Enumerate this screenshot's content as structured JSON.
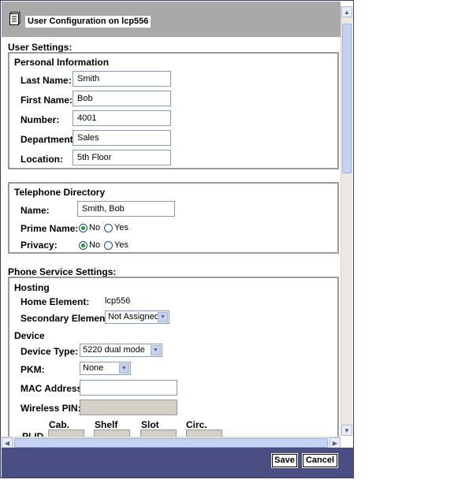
{
  "window": {
    "title": "User Configuration on lcp556",
    "icon": "document-icon"
  },
  "user_settings": {
    "heading": "User Settings:",
    "personal": {
      "heading": "Personal Information",
      "last_name": {
        "label": "Last Name:",
        "value": "Smith"
      },
      "first_name": {
        "label": "First Name:",
        "value": "Bob"
      },
      "number": {
        "label": "Number:",
        "value": "4001"
      },
      "department": {
        "label": "Department:",
        "value": "Sales"
      },
      "location": {
        "label": "Location:",
        "value": "5th Floor"
      }
    },
    "directory": {
      "heading": "Telephone Directory",
      "name": {
        "label": "Name:",
        "value": "Smith, Bob"
      },
      "prime_name": {
        "label": "Prime Name:",
        "options": [
          "No",
          "Yes"
        ],
        "selected": "No"
      },
      "privacy": {
        "label": "Privacy:",
        "options": [
          "No",
          "Yes"
        ],
        "selected": "No"
      }
    }
  },
  "phone_service": {
    "heading": "Phone Service Settings:",
    "hosting": {
      "heading": "Hosting",
      "home_element": {
        "label": "Home Element:",
        "value": "lcp556"
      },
      "secondary_element": {
        "label": "Secondary Element:",
        "selected": "Not Assigned"
      }
    },
    "device": {
      "heading": "Device",
      "device_type": {
        "label": "Device Type:",
        "selected": "5220 dual mode"
      },
      "pkm": {
        "label": "PKM:",
        "selected": "None"
      },
      "mac_address": {
        "label": "MAC Address:",
        "value": ""
      },
      "wireless_pin": {
        "label": "Wireless PIN:",
        "value": ""
      },
      "plid": {
        "label": "PLID",
        "columns": [
          "Cab.",
          "Shelf",
          "Slot",
          "Circ."
        ]
      }
    }
  },
  "footer": {
    "save_label": "Save",
    "cancel_label": "Cancel"
  }
}
